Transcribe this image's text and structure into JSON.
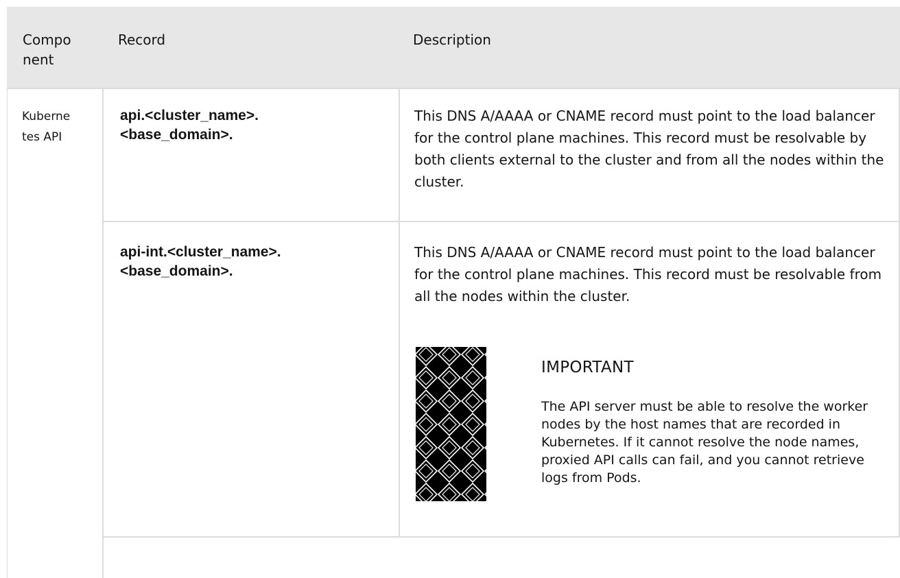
{
  "table": {
    "headers": {
      "component": "Compo nent",
      "component_line1": "Compo",
      "component_line2": "nent",
      "record": "Record",
      "description": "Description"
    },
    "rows": [
      {
        "component_line1": "Kuberne",
        "component_line2": "tes API",
        "record_line1": "api.<cluster_name>.",
        "record_line2": "<base_domain>.",
        "description": "This DNS A/AAAA or CNAME record must point to the load balancer for the control plane machines. This record must be resolvable by both clients external to the cluster and from all the nodes within the cluster."
      },
      {
        "record_line1": "api-int.<cluster_name>.",
        "record_line2": "<base_domain>.",
        "description": "This DNS A/AAAA or CNAME record must point to the load balancer for the control plane machines. This record must be resolvable from all the nodes within the cluster.",
        "admonition": {
          "icon": "important-pattern-icon",
          "title": "IMPORTANT",
          "body": "The API server must be able to resolve the worker nodes by the host names that are recorded in Kubernetes. If it cannot resolve the node names, proxied API calls can fail, and you cannot retrieve logs from Pods."
        }
      }
    ]
  },
  "colors": {
    "header_bg": "#e7e7e7",
    "border": "#dcdcdc",
    "text": "#151515",
    "pattern_bg": "#000000",
    "pattern_line": "#ffffff"
  }
}
